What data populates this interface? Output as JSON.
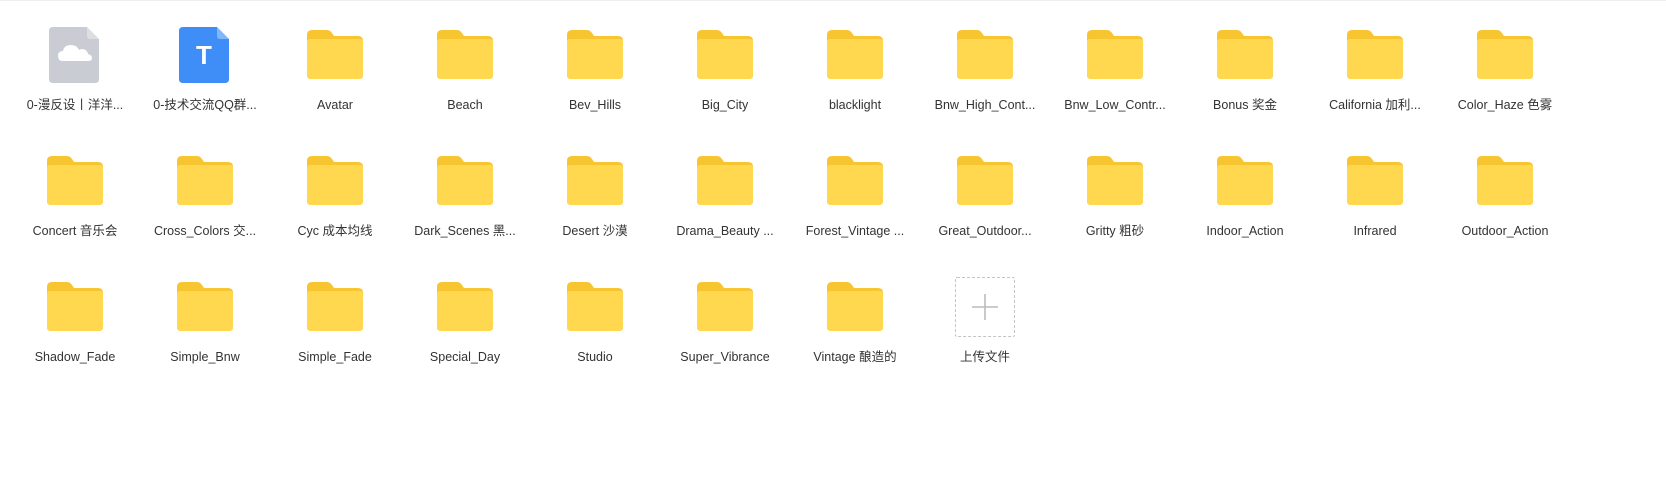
{
  "colors": {
    "folder_back": "#F7C530",
    "folder_front": "#FFD84F",
    "cloud_file": "#C9CCD3",
    "text_file": "#3F8EF7",
    "label_text": "#333333"
  },
  "files": [
    {
      "name": "0-漫反设丨洋洋...",
      "icon": "cloud-file-icon"
    },
    {
      "name": "0-技术交流QQ群...",
      "icon": "text-file-icon",
      "glyph": "T"
    },
    {
      "name": "Avatar",
      "icon": "folder-icon"
    },
    {
      "name": "Beach",
      "icon": "folder-icon"
    },
    {
      "name": "Bev_Hills",
      "icon": "folder-icon"
    },
    {
      "name": "Big_City",
      "icon": "folder-icon"
    },
    {
      "name": "blacklight",
      "icon": "folder-icon"
    },
    {
      "name": "Bnw_High_Cont...",
      "icon": "folder-icon"
    },
    {
      "name": "Bnw_Low_Contr...",
      "icon": "folder-icon"
    },
    {
      "name": "Bonus 奖金",
      "icon": "folder-icon"
    },
    {
      "name": "California 加利...",
      "icon": "folder-icon"
    },
    {
      "name": "Color_Haze 色雾",
      "icon": "folder-icon"
    },
    {
      "name": "Concert 音乐会",
      "icon": "folder-icon"
    },
    {
      "name": "Cross_Colors 交...",
      "icon": "folder-icon"
    },
    {
      "name": "Cyc 成本均线",
      "icon": "folder-icon"
    },
    {
      "name": "Dark_Scenes 黑...",
      "icon": "folder-icon"
    },
    {
      "name": "Desert 沙漠",
      "icon": "folder-icon"
    },
    {
      "name": "Drama_Beauty ...",
      "icon": "folder-icon"
    },
    {
      "name": "Forest_Vintage ...",
      "icon": "folder-icon"
    },
    {
      "name": "Great_Outdoor...",
      "icon": "folder-icon"
    },
    {
      "name": "Gritty 粗砂",
      "icon": "folder-icon"
    },
    {
      "name": "Indoor_Action",
      "icon": "folder-icon"
    },
    {
      "name": "Infrared",
      "icon": "folder-icon"
    },
    {
      "name": "Outdoor_Action",
      "icon": "folder-icon"
    },
    {
      "name": "Shadow_Fade",
      "icon": "folder-icon"
    },
    {
      "name": "Simple_Bnw",
      "icon": "folder-icon"
    },
    {
      "name": "Simple_Fade",
      "icon": "folder-icon"
    },
    {
      "name": "Special_Day",
      "icon": "folder-icon"
    },
    {
      "name": "Studio",
      "icon": "folder-icon"
    },
    {
      "name": "Super_Vibrance",
      "icon": "folder-icon"
    },
    {
      "name": "Vintage 酿造的",
      "icon": "folder-icon"
    }
  ],
  "upload": {
    "label": "上传文件",
    "icon": "plus-icon"
  }
}
